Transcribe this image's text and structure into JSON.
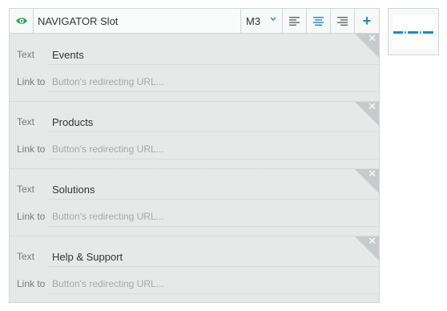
{
  "toolbar": {
    "title": "NAVIGATOR Slot",
    "size_value": "M3",
    "add_label": "+"
  },
  "field_labels": {
    "text": "Text",
    "link": "Link to"
  },
  "items": [
    {
      "text": "Events",
      "link_placeholder": "Button's redirecting URL..."
    },
    {
      "text": "Products",
      "link_placeholder": "Button's redirecting URL..."
    },
    {
      "text": "Solutions",
      "link_placeholder": "Button's redirecting URL..."
    },
    {
      "text": "Help & Support",
      "link_placeholder": "Button's redirecting URL..."
    }
  ],
  "colors": {
    "accent": "#1a8bd0",
    "eye": "#3aa55a"
  },
  "icons": [
    "eye-icon",
    "chevron-down-icon",
    "align-left-icon",
    "align-center-icon",
    "align-right-icon",
    "close-icon",
    "navigator-preview-icon"
  ]
}
